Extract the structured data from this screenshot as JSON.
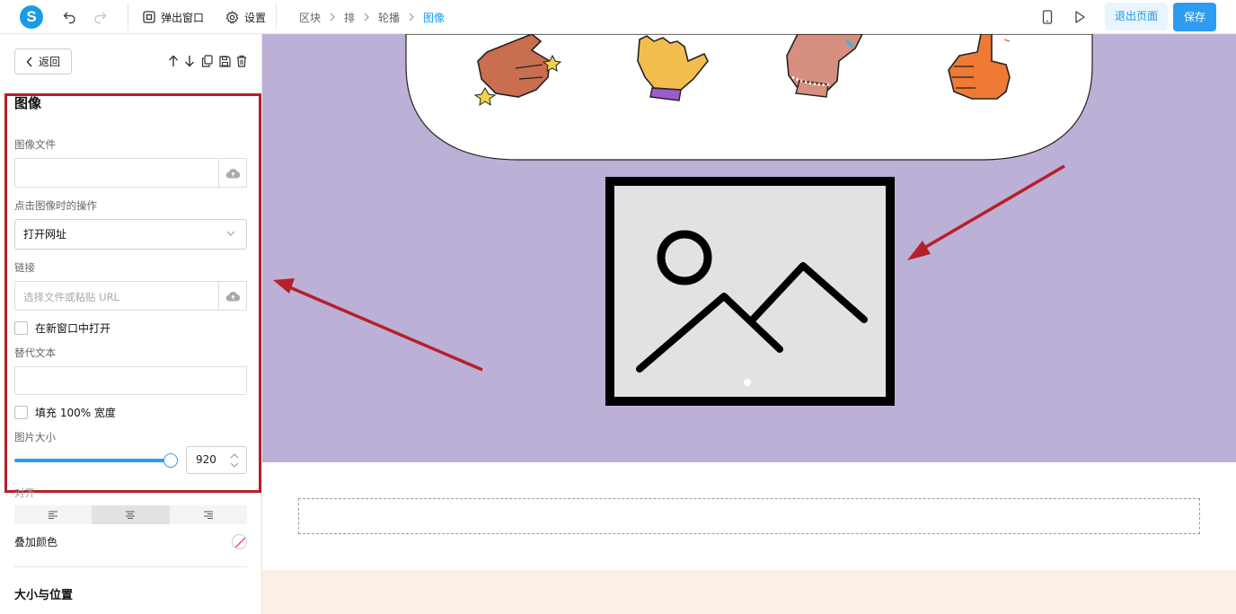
{
  "toolbar": {
    "logo_letter": "S",
    "popup_label": "弹出窗口",
    "settings_label": "设置",
    "exit_label": "退出页面",
    "save_label": "保存"
  },
  "breadcrumb": [
    "区块",
    "排",
    "轮播",
    "图像"
  ],
  "panel": {
    "back_label": "返回",
    "section_title": "图像",
    "image_file_label": "图像文件",
    "click_action_label": "点击图像时的操作",
    "click_action_value": "打开网址",
    "link_label": "链接",
    "link_placeholder": "选择文件或粘贴 URL",
    "new_window_label": "在新窗口中打开",
    "alt_text_label": "替代文本",
    "fill_width_label": "填充 100% 宽度",
    "image_size_label": "图片大小",
    "image_size_value": "920",
    "image_size_fraction": 1.0,
    "align_label": "对齐",
    "align_options": [
      "left",
      "center",
      "right"
    ],
    "align_selected": "center",
    "overlay_color_label": "叠加颜色",
    "size_position_title": "大小与位置"
  },
  "colors": {
    "accent": "#2d9cf0",
    "canvas_purple": "#bdb0d6",
    "annotation_red": "#b5202a",
    "peach_section": "#fcefe6"
  }
}
